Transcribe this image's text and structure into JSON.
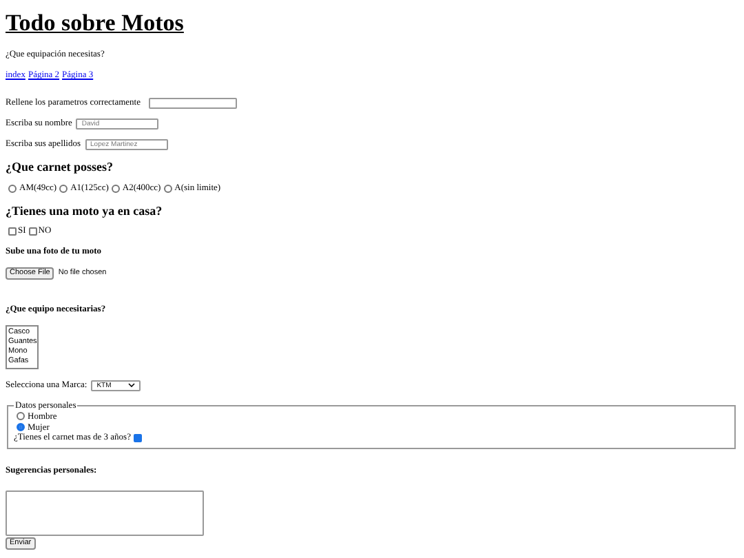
{
  "title": "Todo sobre Motos",
  "intro": "¿Que equipación necesitas?",
  "links": [
    "index",
    "Página 2",
    "Página 3"
  ],
  "fields": [
    {
      "label": "Rellene los parametros correctamente",
      "kind": "wide"
    },
    {
      "label": "Escriba su nombre",
      "placeholder": "David",
      "kind": "short"
    },
    {
      "label": "Escriba sus apellidos",
      "placeholder": "Lopez Martinez",
      "kind": "short"
    }
  ],
  "license_heading": "¿Que carnet posses?",
  "licenses": [
    {
      "label": "AM(49cc)",
      "selected": false
    },
    {
      "label": "A1(125cc)",
      "selected": false
    },
    {
      "label": "A2(400cc)",
      "selected": false
    },
    {
      "label": "A(sin limite)",
      "selected": false
    }
  ],
  "owns_heading": "¿Tienes una moto ya en casa?",
  "owns": [
    {
      "label": "SI",
      "checked": false
    },
    {
      "label": "NO",
      "checked": false
    }
  ],
  "photo_heading": "Sube una foto de tu moto",
  "file": {
    "button": "Choose File",
    "status": "No file chosen"
  },
  "gear_heading": "¿Que equipo necesitarias?",
  "gear": [
    {
      "label": "Casco",
      "selected": false
    },
    {
      "label": "Guantes",
      "selected": false
    },
    {
      "label": "Mono",
      "selected": false
    },
    {
      "label": "Gafas",
      "selected": false
    }
  ],
  "brand": {
    "label": "Selecciona una Marca:",
    "value": "KTM"
  },
  "personal": {
    "legend": "Datos personales",
    "genders": [
      {
        "label": "Hombre",
        "selected": false
      },
      {
        "label": "Mujer",
        "selected": true
      }
    ],
    "experience": {
      "label": "¿Tienes el carnet mas de 3 años?",
      "checked": true
    }
  },
  "suggestions_heading": "Sugerencias personales:",
  "submit": "Enviar"
}
